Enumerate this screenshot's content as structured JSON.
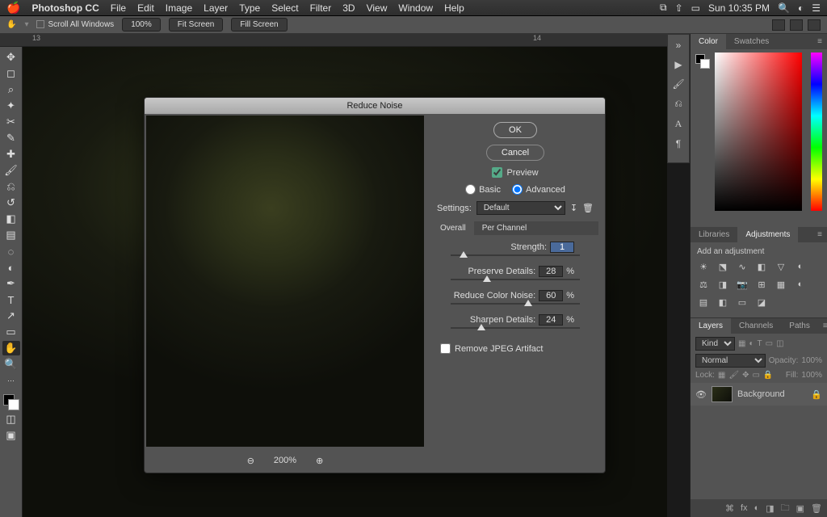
{
  "menubar": {
    "app": "Photoshop CC",
    "items": [
      "File",
      "Edit",
      "Image",
      "Layer",
      "Type",
      "Select",
      "Filter",
      "3D",
      "View",
      "Window",
      "Help"
    ],
    "clock": "Sun 10:35 PM"
  },
  "optbar": {
    "scroll_label": "Scroll All Windows",
    "zoom_pct": "100%",
    "fit_label": "Fit Screen",
    "fill_label": "Fill Screen"
  },
  "ruler": {
    "mark_a": "13",
    "mark_b": "14"
  },
  "panels": {
    "color_tab": "Color",
    "swatches_tab": "Swatches",
    "libraries_tab": "Libraries",
    "adjustments_tab": "Adjustments",
    "add_adjustment": "Add an adjustment",
    "layers_tab": "Layers",
    "channels_tab": "Channels",
    "paths_tab": "Paths",
    "kind_placeholder": "Kind",
    "blend_mode": "Normal",
    "opacity_label": "Opacity:",
    "opacity_val": "100%",
    "lock_label": "Lock:",
    "fill_label": "Fill:",
    "fill_val": "100%",
    "background_layer": "Background"
  },
  "dialog": {
    "title": "Reduce Noise",
    "ok": "OK",
    "cancel": "Cancel",
    "preview": "Preview",
    "basic": "Basic",
    "advanced": "Advanced",
    "settings_label": "Settings:",
    "settings_value": "Default",
    "tab_overall": "Overall",
    "tab_perchannel": "Per Channel",
    "strength_label": "Strength:",
    "strength_val": "1",
    "preserve_label": "Preserve Details:",
    "preserve_val": "28",
    "reduce_color_label": "Reduce Color Noise:",
    "reduce_color_val": "60",
    "sharpen_label": "Sharpen Details:",
    "sharpen_val": "24",
    "pct": "%",
    "remove_jpeg": "Remove JPEG Artifact",
    "zoom_level": "200%"
  }
}
